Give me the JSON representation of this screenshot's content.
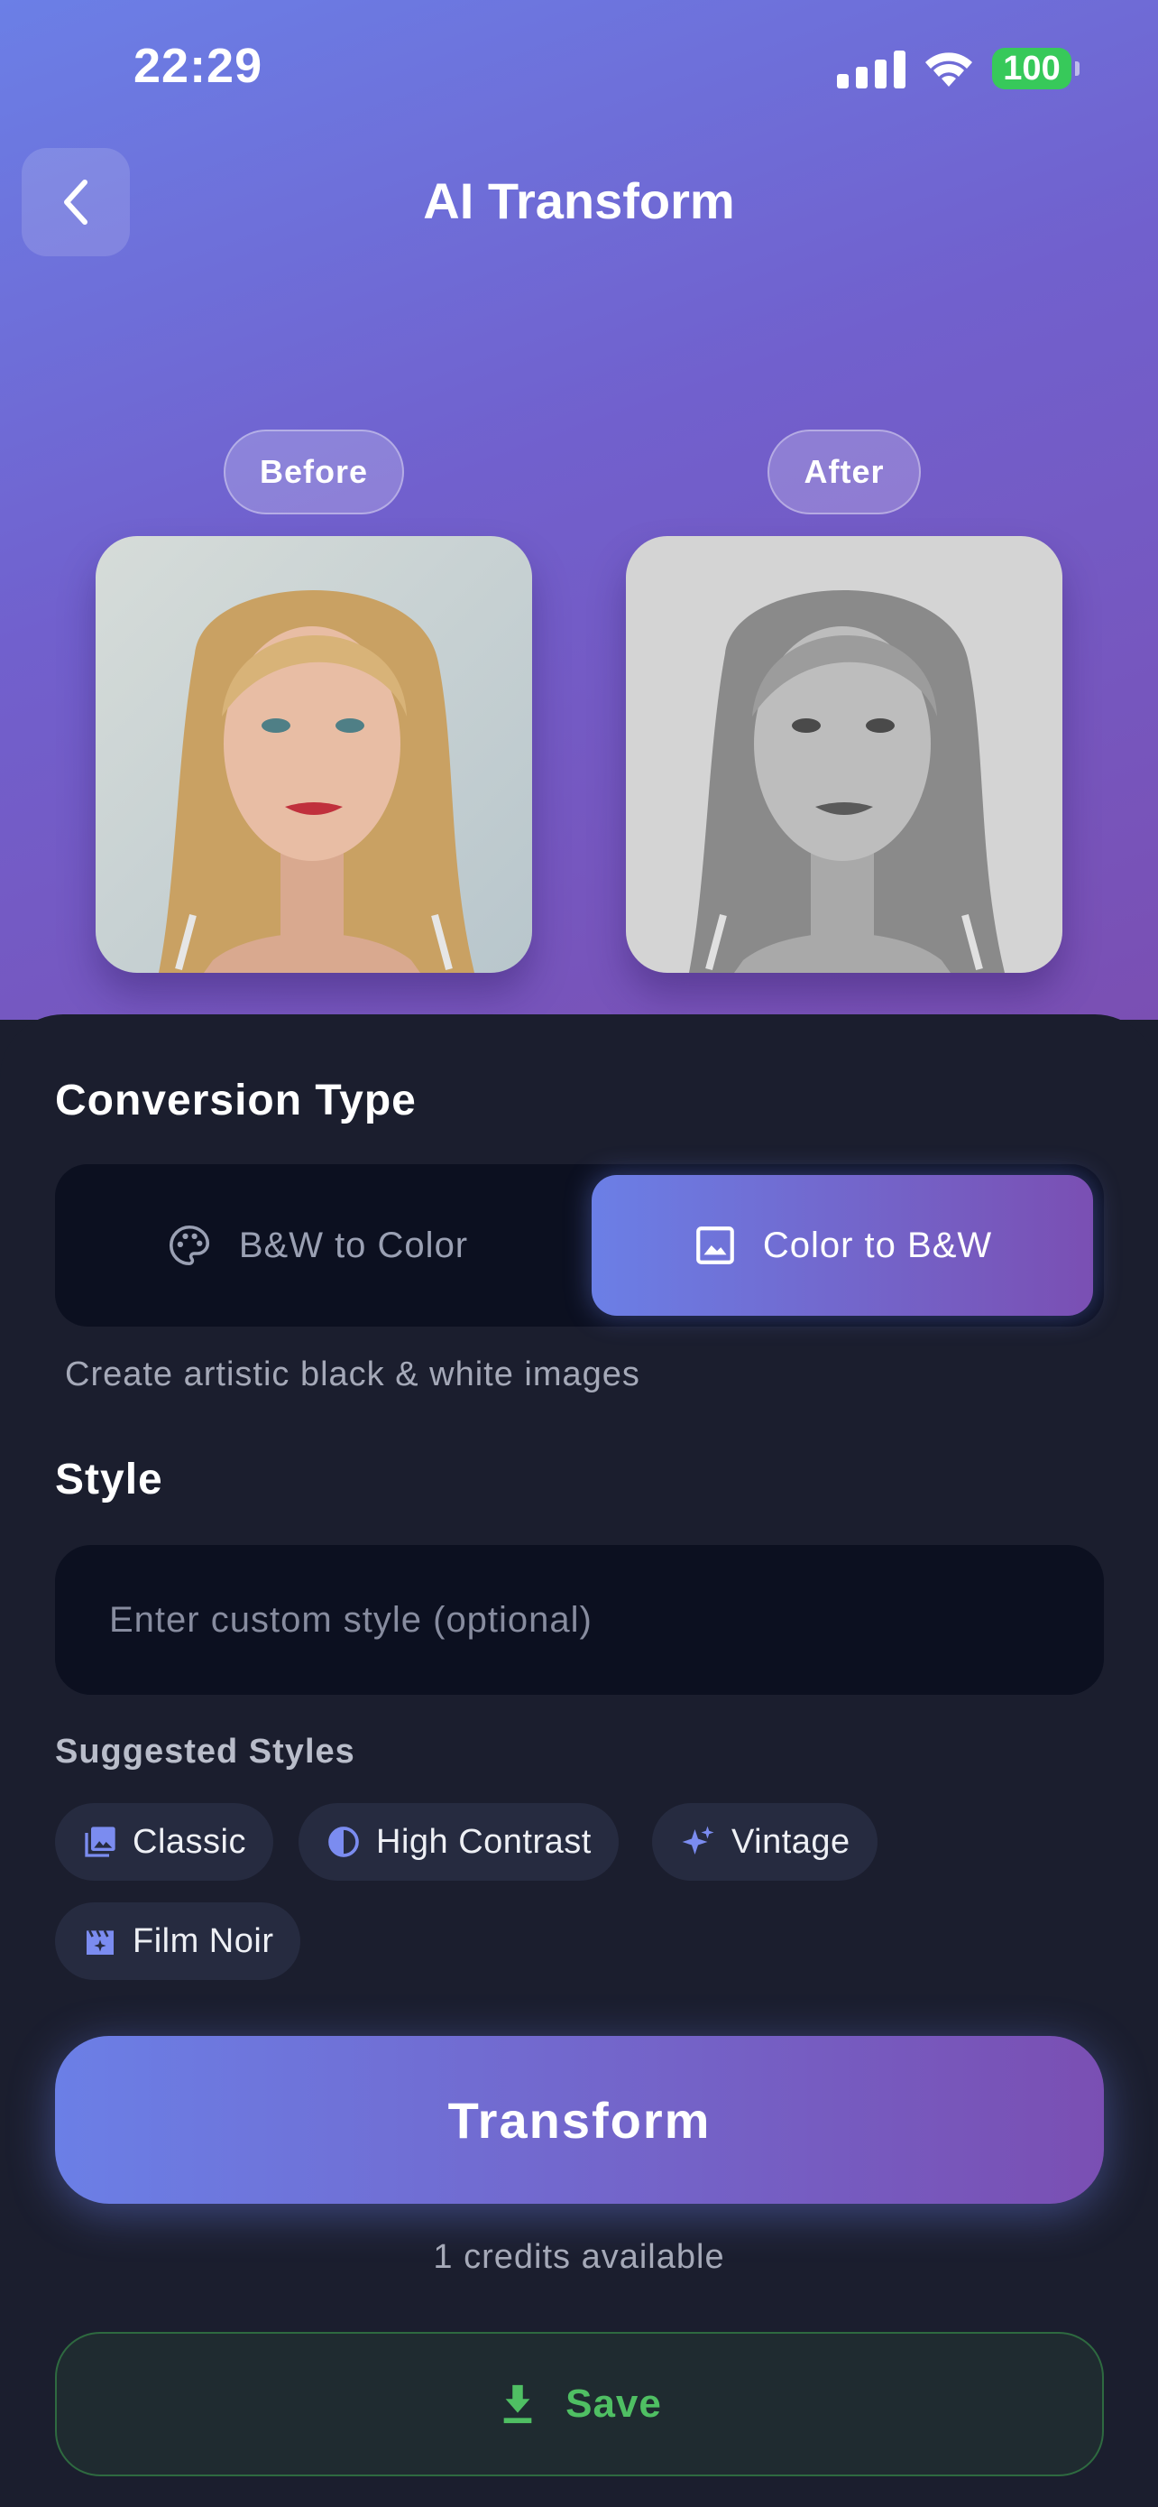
{
  "status_bar": {
    "time": "22:29",
    "battery": "100"
  },
  "header": {
    "title": "AI Transform"
  },
  "comparison": {
    "before_label": "Before",
    "after_label": "After"
  },
  "conversion": {
    "title": "Conversion Type",
    "options": [
      {
        "label": "B&W to Color",
        "icon": "palette-icon",
        "selected": false
      },
      {
        "label": "Color to B&W",
        "icon": "image-icon",
        "selected": true
      }
    ],
    "helper_text": "Create artistic black & white images"
  },
  "style": {
    "title": "Style",
    "input_placeholder": "Enter custom style (optional)",
    "input_value": ""
  },
  "suggested": {
    "title": "Suggested Styles",
    "chips": [
      {
        "label": "Classic",
        "icon": "photo-library-icon"
      },
      {
        "label": "High Contrast",
        "icon": "contrast-icon"
      },
      {
        "label": "Vintage",
        "icon": "sparkle-icon"
      },
      {
        "label": "Film Noir",
        "icon": "movie-filter-icon"
      }
    ]
  },
  "actions": {
    "transform_label": "Transform",
    "credits_text": "1 credits available",
    "save_label": "Save"
  },
  "colors": {
    "accent_start": "#6b7fe6",
    "accent_end": "#7a4fb3",
    "panel_bg": "#1b1e2e",
    "save_green": "#4fbf63"
  }
}
